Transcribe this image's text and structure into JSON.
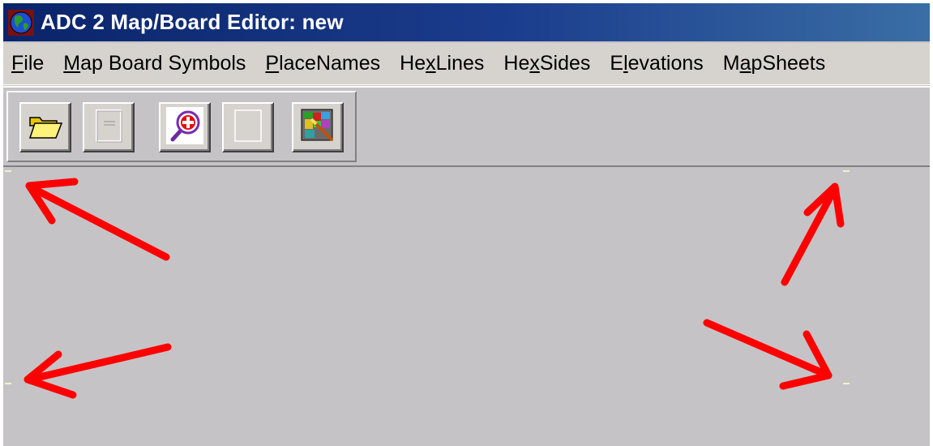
{
  "window": {
    "title": "ADC 2 Map/Board Editor: new",
    "app_icon": "globe-icon"
  },
  "menu": {
    "items": [
      {
        "pre": "",
        "key": "F",
        "post": "ile"
      },
      {
        "pre": "",
        "key": "M",
        "post": "ap Board Symbols"
      },
      {
        "pre": "",
        "key": "P",
        "post": "laceNames"
      },
      {
        "pre": "He",
        "key": "x",
        "post": "Lines"
      },
      {
        "pre": "He",
        "key": "x",
        "post": "Sides"
      },
      {
        "pre": "E",
        "key": "l",
        "post": "evations"
      },
      {
        "pre": "M",
        "key": "a",
        "post": "pSheets"
      }
    ]
  },
  "toolbar": {
    "buttons": [
      {
        "icon": "open-folder-icon",
        "enabled": true
      },
      {
        "icon": "blank-document-icon",
        "enabled": false
      },
      {
        "icon": "zoom-in-icon",
        "enabled": true
      },
      {
        "icon": "blank-icon",
        "enabled": false
      },
      {
        "icon": "map-tool-icon",
        "enabled": true
      }
    ]
  },
  "annotations": {
    "color": "#ff0000",
    "arrows": [
      "arrow-top-left",
      "arrow-bottom-left",
      "arrow-top-right",
      "arrow-bottom-right"
    ]
  },
  "colors": {
    "titlebar": "#0a246a",
    "background": "#c5c3c5",
    "menubar": "#d6d3ce"
  }
}
